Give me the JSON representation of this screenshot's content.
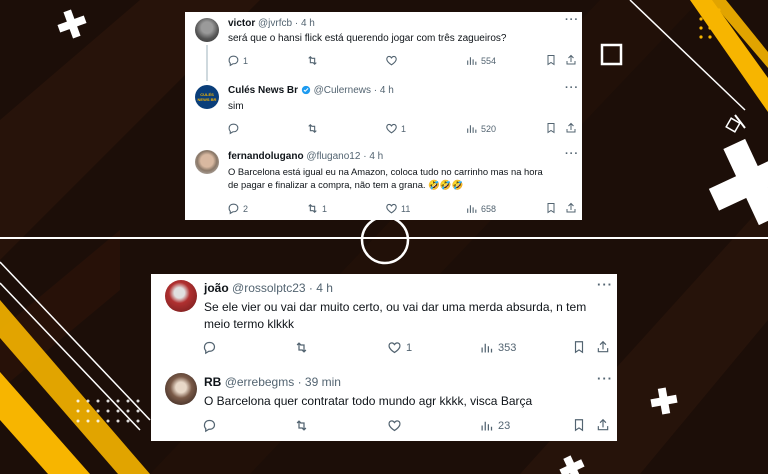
{
  "colors": {
    "background": "#1c0e08",
    "accent_yellow": "#f7b500",
    "text": "#0f1419",
    "muted": "#536471",
    "verified": "#1d9bf0"
  },
  "top_card": {
    "tweets": [
      {
        "name": "victor",
        "handle": "@jvrfcb",
        "time": "· 4 h",
        "text": "será que o hansi flick está querendo jogar com três zagueiros?",
        "replies": "1",
        "retweets": "",
        "likes": "",
        "views": "554"
      },
      {
        "name": "Culés News Br",
        "handle": "@Culernews",
        "time": "· 4 h",
        "text": "sim",
        "replies": "",
        "retweets": "",
        "likes": "1",
        "views": "520",
        "avatar_text": "CULÉS NEWS BR"
      },
      {
        "name": "fernandolugano",
        "handle": "@flugano12",
        "time": "· 4 h",
        "text_line1": "O Barcelona está igual eu na Amazon, coloca tudo no carrinho mas na hora",
        "text_line2": "de pagar e finalizar a compra, não tem a grana. 🤣🤣🤣",
        "replies": "2",
        "retweets": "1",
        "likes": "11",
        "views": "658"
      }
    ]
  },
  "bottom_card": {
    "tweets": [
      {
        "name": "joão",
        "handle": "@rossolptc23",
        "time": "· 4 h",
        "text_line1": "Se ele vier ou vai dar muito certo, ou vai dar uma merda absurda, n tem",
        "text_line2": "meio termo klkkk",
        "replies": "",
        "retweets": "",
        "likes": "1",
        "views": "353"
      },
      {
        "name": "RB",
        "handle": "@errebegms",
        "time": "· 39 min",
        "text": "O Barcelona quer contratar todo mundo agr kkkk, visca Barça",
        "replies": "",
        "retweets": "",
        "likes": "",
        "views": "23"
      }
    ]
  },
  "icons": [
    "reply-icon",
    "retweet-icon",
    "like-icon",
    "views-icon",
    "bookmark-icon",
    "share-icon",
    "more-icon",
    "verified-icon"
  ]
}
